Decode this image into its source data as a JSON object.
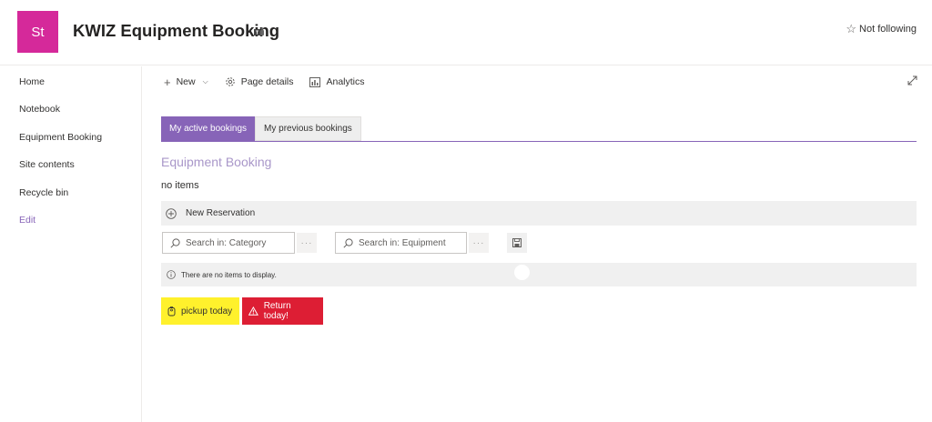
{
  "header": {
    "logo_initials": "St",
    "site_title": "KWIZ Equipment Booking",
    "follow_label": "Not following",
    "logo_color": "#d5299a"
  },
  "sidebar": {
    "items": [
      {
        "label": "Home"
      },
      {
        "label": "Notebook"
      },
      {
        "label": "Equipment Booking"
      },
      {
        "label": "Site contents"
      },
      {
        "label": "Recycle bin"
      },
      {
        "label": "Edit"
      }
    ]
  },
  "commandbar": {
    "new_label": "New",
    "page_details_label": "Page details",
    "analytics_label": "Analytics"
  },
  "tabs": [
    {
      "label": "My active bookings",
      "active": true
    },
    {
      "label": "My previous bookings",
      "active": false
    }
  ],
  "list": {
    "title": "Equipment Booking",
    "empty_text": "no items",
    "new_reservation_label": "New Reservation",
    "search_category_placeholder": "Search in: Category",
    "search_equipment_placeholder": "Search in: Equipment",
    "no_items_message": "There are no items to display."
  },
  "status_buttons": {
    "pickup_label": "pickup today",
    "return_label": "Return today!",
    "pickup_color": "#fff12c",
    "return_color": "#dd1e34"
  },
  "accent_color": "#8764b8"
}
